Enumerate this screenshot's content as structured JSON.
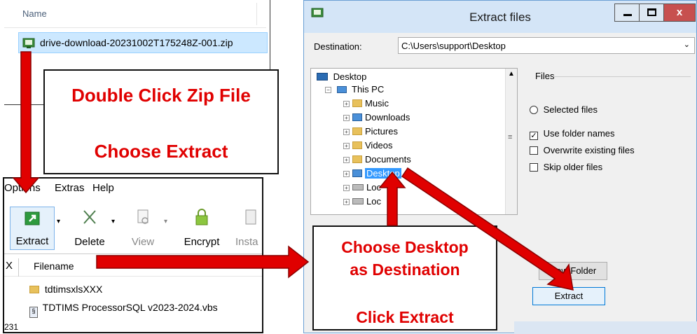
{
  "explorer": {
    "column_header": "Name",
    "zip_file": "drive-download-20231002T175248Z-001.zip"
  },
  "archiver": {
    "menu": [
      "Options",
      "Extras",
      "Help"
    ],
    "toolbar": {
      "extract": "Extract",
      "delete": "Delete",
      "view": "View",
      "encrypt": "Encrypt",
      "install": "Insta"
    },
    "column_x": "X",
    "column_filename": "Filename",
    "files": [
      "tdtimsxlsXXX",
      "TDTIMS ProcessorSQL v2023-2024.vbs"
    ],
    "side_number": "231"
  },
  "dialog": {
    "title": "Extract files",
    "destination_label": "Destination:",
    "destination_value": "C:\\Users\\support\\Desktop",
    "tree": {
      "root": "Desktop",
      "this_pc": "This PC",
      "items": [
        "Music",
        "Downloads",
        "Pictures",
        "Videos",
        "Documents",
        "Desktop",
        "Local Disk",
        "Local Disk (D:)"
      ],
      "items_visible": [
        "Music",
        "Downloads",
        "Pictures",
        "Videos",
        "Documents",
        "Desktop",
        "Loc",
        "Loc"
      ],
      "selected": "Desktop"
    },
    "files_group_label": "Files",
    "selected_files": "Selected files",
    "use_folder_names": "Use folder names",
    "overwrite": "Overwrite existing files",
    "skip_older": "Skip older files",
    "new_folder": "New Folder",
    "extract_button": "Extract"
  },
  "callouts": {
    "double_click": "Double Click Zip File",
    "choose_extract": "Choose Extract",
    "choose_desktop": "Choose Desktop",
    "as_destination": "as Destination",
    "click_extract": "Click Extract",
    "color": "#e00000"
  }
}
